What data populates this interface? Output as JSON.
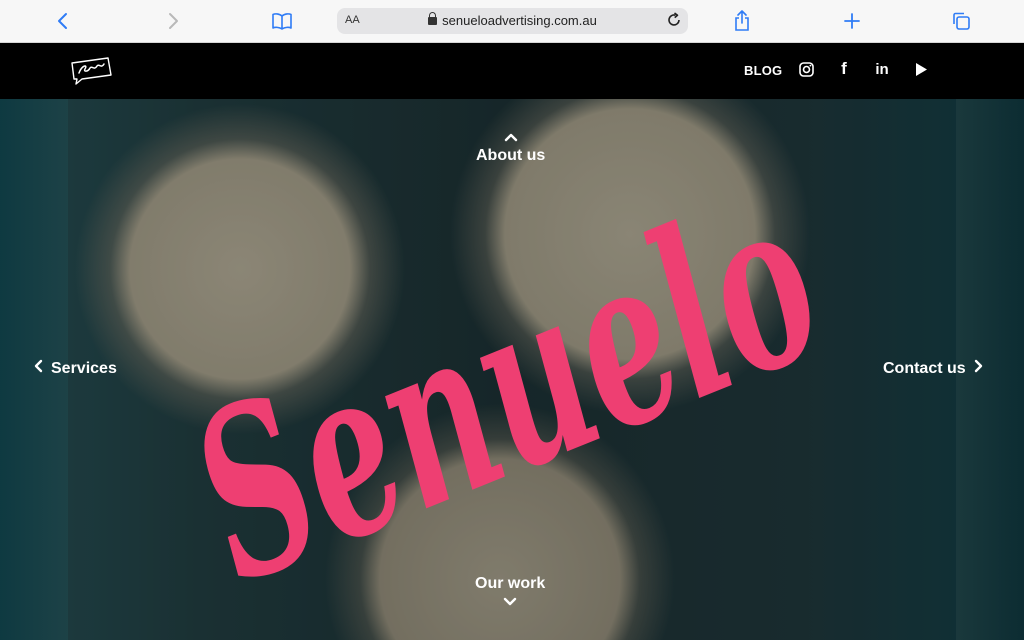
{
  "browser": {
    "address_size_label": "AA",
    "url": "senueloadvertising.com.au",
    "accent_color": "#2f7cf6"
  },
  "site": {
    "logo_text": "Senuelo",
    "header": {
      "blog_label": "BLOG",
      "social_icons": [
        "instagram-icon",
        "facebook-icon",
        "linkedin-icon",
        "youtube-icon"
      ],
      "linkedin_text": "in",
      "facebook_text": "f"
    },
    "hero": {
      "brand_script": "Senuelo",
      "brand_color": "#ee3f72",
      "nav": {
        "top": "About us",
        "left": "Services",
        "right": "Contact us",
        "bottom": "Our work"
      }
    }
  }
}
